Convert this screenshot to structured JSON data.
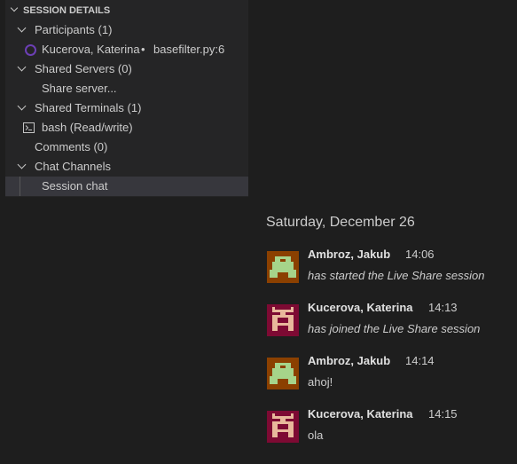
{
  "sidebar": {
    "header": "SESSION DETAILS",
    "participants": "Participants (1)",
    "participant": {
      "name": "Kucerova, Katerina",
      "separator": "•",
      "location": "basefilter.py:6",
      "color": "#6c3fb5"
    },
    "servers": "Shared Servers (0)",
    "share_server": "Share server...",
    "terminals": "Shared Terminals (1)",
    "terminal": "bash (Read/write)",
    "comments": "Comments (0)",
    "channels": "Chat Channels",
    "session_chat": "Session chat"
  },
  "chat": {
    "date": "Saturday, December 26",
    "messages": [
      {
        "author": "Ambroz, Jakub",
        "time": "14:06",
        "text": "has started the Live Share session",
        "system": true
      },
      {
        "author": "Kucerova, Katerina",
        "time": "14:13",
        "text": "has joined the Live Share session",
        "system": true
      },
      {
        "author": "Ambroz, Jakub",
        "time": "14:14",
        "text": "ahoj!",
        "system": false
      },
      {
        "author": "Kucerova, Katerina",
        "time": "14:15",
        "text": "ola",
        "system": false
      }
    ]
  }
}
